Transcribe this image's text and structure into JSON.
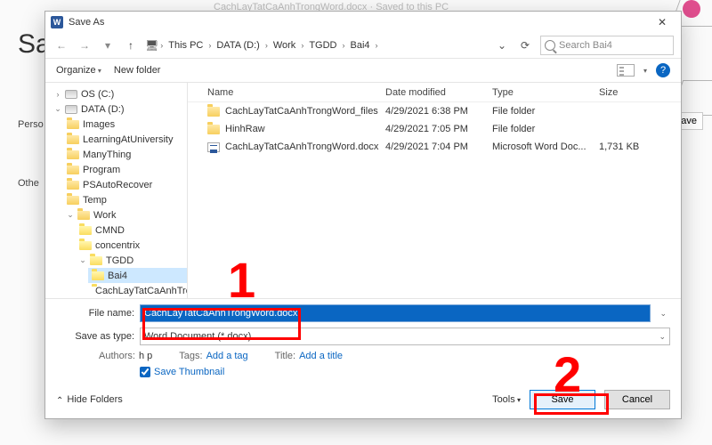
{
  "bg": {
    "doc_hint": "CachLayTatCaAnhTrongWord.docx · Saved to this PC",
    "cut_title": "Sa",
    "personal": "Perso",
    "other": "Othe",
    "save_btn": "Save"
  },
  "titlebar": {
    "title": "Save As"
  },
  "nav": {
    "crumbs": [
      "This PC",
      "DATA (D:)",
      "Work",
      "TGDD",
      "Bai4"
    ],
    "search_placeholder": "Search Bai4"
  },
  "toolbar": {
    "organize": "Organize",
    "new_folder": "New folder"
  },
  "tree": {
    "os": "OS (C:)",
    "data": "DATA (D:)",
    "items_d1": [
      "Images",
      "LearningAtUniversity",
      "ManyThing",
      "Program",
      "PSAutoRecover",
      "Temp",
      "Work"
    ],
    "items_d2": [
      "CMND",
      "concentrix",
      "TGDD"
    ],
    "items_d3_sel": "Bai4",
    "items_d3_next": "CachLayTatCaAnhTro"
  },
  "columns": {
    "name": "Name",
    "date": "Date modified",
    "type": "Type",
    "size": "Size"
  },
  "files": [
    {
      "icon": "folder",
      "name": "CachLayTatCaAnhTrongWord_files",
      "date": "4/29/2021 6:38 PM",
      "type": "File folder",
      "size": ""
    },
    {
      "icon": "folder",
      "name": "HinhRaw",
      "date": "4/29/2021 7:05 PM",
      "type": "File folder",
      "size": ""
    },
    {
      "icon": "doc",
      "name": "CachLayTatCaAnhTrongWord.docx",
      "date": "4/29/2021 7:04 PM",
      "type": "Microsoft Word Doc...",
      "size": "1,731 KB"
    }
  ],
  "form": {
    "filename_label": "File name:",
    "filename_value": "CachLayTatCaAnhTrongWord.docx",
    "savetype_label": "Save as type:",
    "savetype_value": "Word Document (*.docx)",
    "authors_k": "Authors:",
    "authors_v": "h p",
    "tags_k": "Tags:",
    "tags_v": "Add a tag",
    "title_k": "Title:",
    "title_v": "Add a title",
    "save_thumb": "Save Thumbnail"
  },
  "footer": {
    "hide_folders": "Hide Folders",
    "tools": "Tools",
    "save": "Save",
    "cancel": "Cancel"
  },
  "anno": {
    "one": "1",
    "two": "2"
  }
}
